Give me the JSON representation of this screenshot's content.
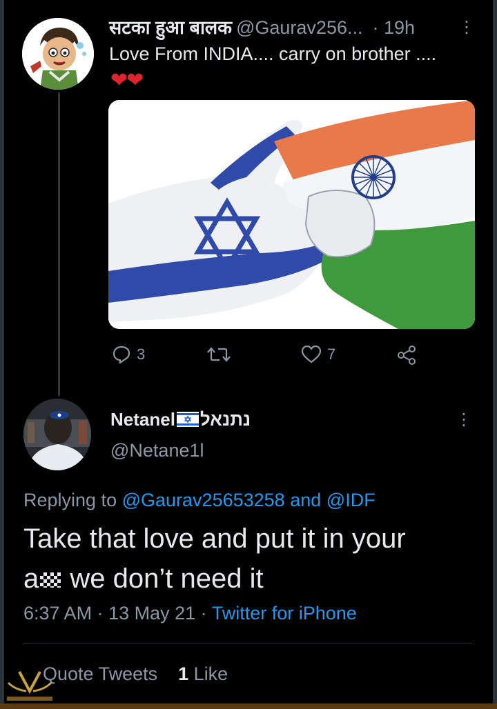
{
  "first_tweet": {
    "display_name": "सटका हुआ बालक",
    "handle": "@Gaurav256...",
    "time": "· 19h",
    "more_icon": "⋮",
    "text": "Love From INDIA....  carry on brother ....",
    "emoji": "❤❤",
    "actions": {
      "reply_count": "3",
      "retweet_count": "",
      "like_count": "7"
    }
  },
  "second_tweet": {
    "display_name_left": "Netanel",
    "display_name_right": "נתנאל",
    "handle": "@Netane1l",
    "more_icon": "⋮",
    "replying_prefix": "Replying to",
    "replying_user1": "@Gaurav25653258",
    "replying_and": "and",
    "replying_user2": "@IDF",
    "text_line1": "Take that love and put it in your",
    "text_line2_start": "a",
    "text_line2_end": "we don’t need it",
    "time": "6:37 AM",
    "date": "13 May 21",
    "source": "Twitter for iPhone",
    "quote_tweets_label": "Quote Tweets",
    "likes_count": "1",
    "likes_label": "Like"
  },
  "colors": {
    "background": "#000000",
    "text": "#e7e9ea",
    "muted": "#8b98a5",
    "link": "#1d9bf0",
    "heart": "#e0242c"
  }
}
